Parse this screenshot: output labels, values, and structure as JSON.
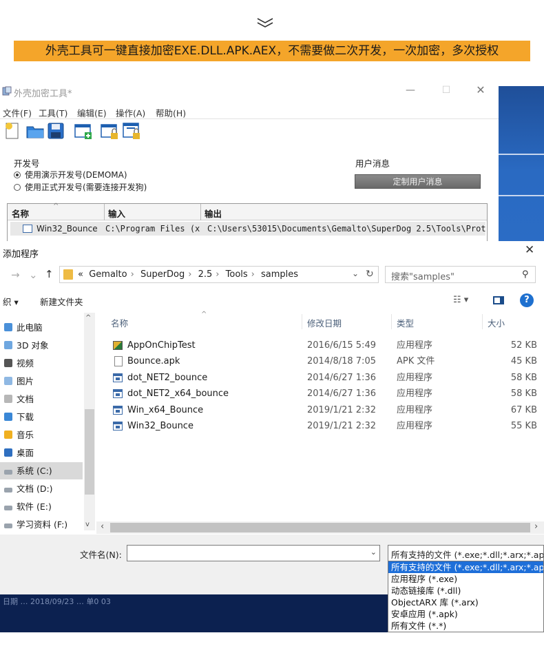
{
  "banner": {
    "text": "外壳工具可一键直接加密EXE.DLL.APK.AEX，不需要做二次开发，一次加密，多次授权",
    "color": "#f4a52a"
  },
  "app": {
    "title": "外壳加密工具*",
    "menu": [
      "文件(F)",
      "工具(T)",
      "编辑(E)",
      "操作(A)",
      "帮助(H)"
    ],
    "toolbar_icons": [
      "new-file-icon",
      "open-folder-icon",
      "save-icon",
      "add-window-icon",
      "lock-window-icon",
      "lock-window-2-icon"
    ],
    "dev_group": {
      "title": "开发号",
      "options": [
        "使用演示开发号(DEMOMA)",
        "使用正式开发号(需要连接开发狗)"
      ]
    },
    "user_group": {
      "title": "用户消息",
      "button": "定制用户消息"
    },
    "table": {
      "headers": [
        "名称",
        "输入",
        "输出"
      ],
      "row": {
        "name": "Win32_Bounce",
        "input": "C:\\Program Files (x",
        "output": "C:\\Users\\53015\\Documents\\Gemalto\\SuperDog 2.5\\Tools\\Prot…"
      }
    }
  },
  "dialog": {
    "title": "添加程序",
    "breadcrumb_prefix": "«",
    "breadcrumb": [
      "Gemalto",
      "SuperDog",
      "2.5",
      "Tools",
      "samples"
    ],
    "search_placeholder": "搜索\"samples\"",
    "organize": "织 ▾",
    "new_folder": "新建文件夹",
    "nav": [
      {
        "label": "此电脑",
        "icon": "pc-icon"
      },
      {
        "label": "3D 对象",
        "icon": "3d-objects-icon"
      },
      {
        "label": "视频",
        "icon": "video-icon"
      },
      {
        "label": "图片",
        "icon": "pictures-icon"
      },
      {
        "label": "文档",
        "icon": "documents-icon"
      },
      {
        "label": "下载",
        "icon": "downloads-icon"
      },
      {
        "label": "音乐",
        "icon": "music-icon"
      },
      {
        "label": "桌面",
        "icon": "desktop-icon"
      },
      {
        "label": "系统 (C:)",
        "icon": "drive-icon",
        "selected": true
      },
      {
        "label": "文档 (D:)",
        "icon": "drive-icon"
      },
      {
        "label": "软件 (E:)",
        "icon": "drive-icon"
      },
      {
        "label": "学习资料 (F:)",
        "icon": "drive-icon"
      }
    ],
    "columns": [
      "名称",
      "修改日期",
      "类型",
      "大小"
    ],
    "files": [
      {
        "name": "AppOnChipTest",
        "date": "2016/6/15 5:49",
        "type": "应用程序",
        "size": "52 KB",
        "icon": "chip"
      },
      {
        "name": "Bounce.apk",
        "date": "2014/8/18 7:05",
        "type": "APK 文件",
        "size": "45 KB",
        "icon": "apk"
      },
      {
        "name": "dot_NET2_bounce",
        "date": "2014/6/27 1:36",
        "type": "应用程序",
        "size": "58 KB",
        "icon": "exe"
      },
      {
        "name": "dot_NET2_x64_bounce",
        "date": "2014/6/27 1:36",
        "type": "应用程序",
        "size": "58 KB",
        "icon": "exe"
      },
      {
        "name": "Win_x64_Bounce",
        "date": "2019/1/21 2:32",
        "type": "应用程序",
        "size": "67 KB",
        "icon": "exe"
      },
      {
        "name": "Win32_Bounce",
        "date": "2019/1/21 2:32",
        "type": "应用程序",
        "size": "55 KB",
        "icon": "exe"
      }
    ],
    "filename_label": "文件名(N):",
    "filename_value": "",
    "filetype_value": "所有支持的文件 (*.exe;*.dll;*.arx;*.ap",
    "filetype_options": [
      "所有支持的文件 (*.exe;*.dll;*.arx;*.ap",
      "应用程序 (*.exe)",
      "动态链接库 (*.dll)",
      "ObjectARX 库 (*.arx)",
      "安卓应用 (*.apk)",
      "所有文件 (*.*)"
    ],
    "taskbar_text": "日期 …  2018/09/23  …  单0 03"
  }
}
